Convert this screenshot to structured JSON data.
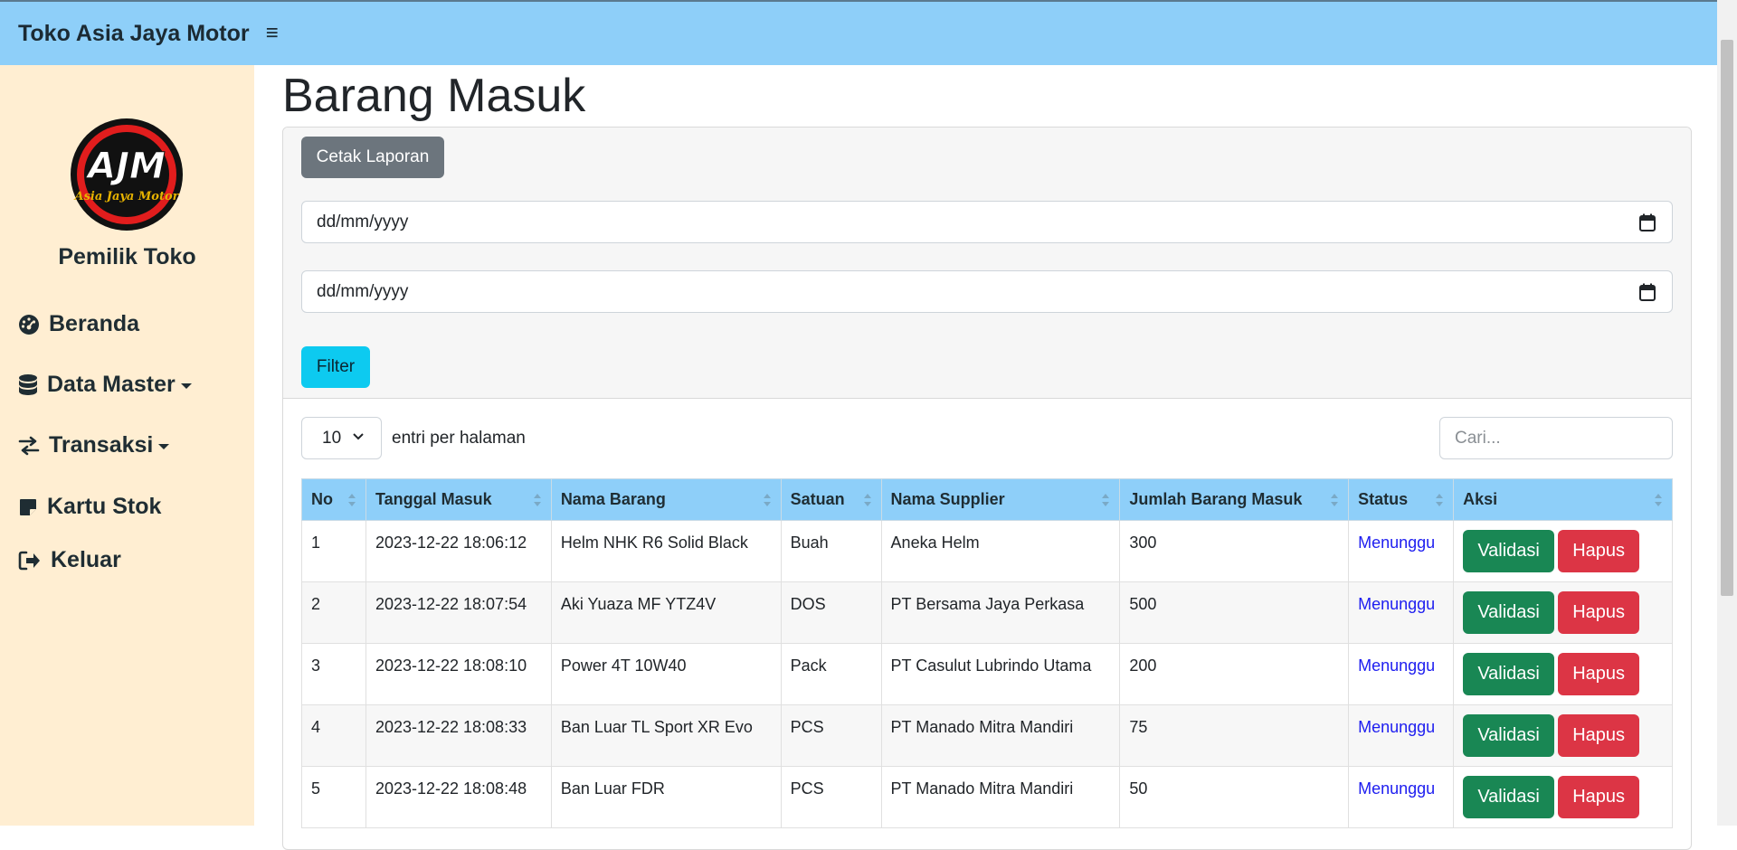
{
  "header": {
    "brand": "Toko Asia Jaya Motor"
  },
  "sidebar": {
    "logo_text": "AJM",
    "logo_subtext": "Asia Jaya Motor",
    "role": "Pemilik Toko",
    "items": [
      {
        "label": "Beranda",
        "icon": "dashboard-icon"
      },
      {
        "label": "Data Master",
        "icon": "database-icon",
        "dropdown": true
      },
      {
        "label": "Transaksi",
        "icon": "transfer-icon",
        "dropdown": true
      },
      {
        "label": "Kartu Stok",
        "icon": "note-icon"
      },
      {
        "label": "Keluar",
        "icon": "logout-icon"
      }
    ]
  },
  "page": {
    "title": "Barang Masuk"
  },
  "filter": {
    "print_label": "Cetak Laporan",
    "date_from_placeholder": "dd/mm/yyyy",
    "date_to_placeholder": "dd/mm/yyyy",
    "filter_label": "Filter"
  },
  "table_controls": {
    "per_page_value": "10",
    "per_page_label": "entri per halaman",
    "search_placeholder": "Cari..."
  },
  "table": {
    "columns": [
      "No",
      "Tanggal Masuk",
      "Nama Barang",
      "Satuan",
      "Nama Supplier",
      "Jumlah Barang Masuk",
      "Status",
      "Aksi"
    ],
    "rows": [
      {
        "no": "1",
        "tanggal": "2023-12-22 18:06:12",
        "barang": "Helm NHK R6 Solid Black",
        "satuan": "Buah",
        "supplier": "Aneka Helm",
        "jumlah": "300",
        "status": "Menunggu"
      },
      {
        "no": "2",
        "tanggal": "2023-12-22 18:07:54",
        "barang": "Aki Yuaza MF YTZ4V",
        "satuan": "DOS",
        "supplier": "PT Bersama Jaya Perkasa",
        "jumlah": "500",
        "status": "Menunggu"
      },
      {
        "no": "3",
        "tanggal": "2023-12-22 18:08:10",
        "barang": "Power 4T 10W40",
        "satuan": "Pack",
        "supplier": "PT Casulut Lubrindo Utama",
        "jumlah": "200",
        "status": "Menunggu"
      },
      {
        "no": "4",
        "tanggal": "2023-12-22 18:08:33",
        "barang": "Ban Luar TL Sport XR Evo",
        "satuan": "PCS",
        "supplier": "PT Manado Mitra Mandiri",
        "jumlah": "75",
        "status": "Menunggu"
      },
      {
        "no": "5",
        "tanggal": "2023-12-22 18:08:48",
        "barang": "Ban Luar FDR",
        "satuan": "PCS",
        "supplier": "PT Manado Mitra Mandiri",
        "jumlah": "50",
        "status": "Menunggu"
      }
    ],
    "validate_label": "Validasi",
    "delete_label": "Hapus"
  },
  "colors": {
    "topbar": "#8ecff9",
    "sidebar": "#ffeed2",
    "validate": "#198754",
    "delete": "#dc3545",
    "filter": "#0dcaf0",
    "print": "#6c757d"
  }
}
